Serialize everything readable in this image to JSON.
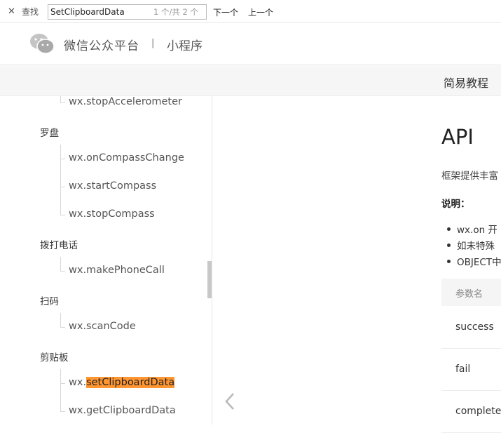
{
  "findbar": {
    "close_glyph": "✕",
    "label": "查找",
    "query": "SetClipboardData",
    "count": "1 个/共 2 个",
    "next": "下一个",
    "prev": "上一个"
  },
  "header": {
    "brand": "微信公众平台",
    "separator": "|",
    "product": "小程序"
  },
  "subnav": {
    "link": "简易教程"
  },
  "sidebar": {
    "items": [
      {
        "type": "item",
        "label": "wx.stopAccelerometer"
      },
      {
        "type": "category",
        "label": "罗盘"
      },
      {
        "type": "item",
        "label": "wx.onCompassChange"
      },
      {
        "type": "item",
        "label": "wx.startCompass"
      },
      {
        "type": "item",
        "label": "wx.stopCompass"
      },
      {
        "type": "category",
        "label": "拨打电话"
      },
      {
        "type": "item",
        "label": "wx.makePhoneCall"
      },
      {
        "type": "category",
        "label": "扫码"
      },
      {
        "type": "item",
        "label": "wx.scanCode"
      },
      {
        "type": "category",
        "label": "剪贴板"
      },
      {
        "type": "item",
        "label_prefix": "wx.",
        "label_match": "setClipboardData",
        "highlight_color": "#ff9632"
      },
      {
        "type": "item",
        "label": "wx.getClipboardData"
      }
    ]
  },
  "content": {
    "title": "API",
    "intro": "框架提供丰富",
    "note": "说明：",
    "bullets": [
      "wx.on 开",
      "如未特殊",
      "OBJECT中"
    ],
    "table": {
      "header": "参数名",
      "rows": [
        "success",
        "fail",
        "complete"
      ]
    }
  },
  "icons": {
    "logo": "wechat-logo-icon",
    "back": "chevron-left-icon",
    "close": "close-icon"
  }
}
